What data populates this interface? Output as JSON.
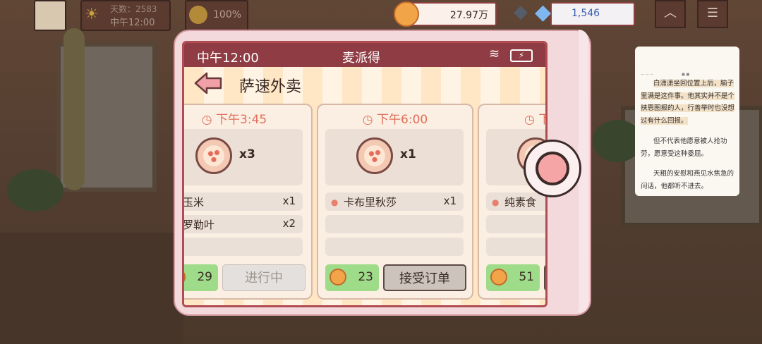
{
  "hud": {
    "days_label": "天数：2583",
    "clock_label": "中午12:00",
    "mood_percent": "100%",
    "coins": "27.97万",
    "gems": "1,546"
  },
  "phone": {
    "status_time": "中午12:00",
    "app_name": "麦派得",
    "page_title": "萨速外卖"
  },
  "orders": [
    {
      "time": "下午3:45",
      "quantity": "x3",
      "items": [
        {
          "name": "玉米",
          "qty": "x1"
        },
        {
          "name": "罗勒叶",
          "qty": "x2"
        }
      ],
      "reward": "29",
      "action": "进行中"
    },
    {
      "time": "下午6:00",
      "quantity": "x1",
      "items": [
        {
          "name": "卡布里秋莎",
          "qty": "x1"
        }
      ],
      "reward": "23",
      "action": "接受订单"
    },
    {
      "time": "下午",
      "quantity": "",
      "items": [
        {
          "name": "纯素食",
          "qty": ""
        }
      ],
      "reward": "51",
      "action": ""
    }
  ],
  "reader": {
    "paragraph1": "白潇潇坐回位置上后，脑子里满是这件事。他其实并不是个挟恩图报的人，行善举时也没想过有什么回报。",
    "paragraph2": "但不代表他愿意被人抢功劳，愿意受这种委屈。",
    "paragraph3": "天粗的安慰和燕见水焦急的问话，他都听不进去。"
  }
}
